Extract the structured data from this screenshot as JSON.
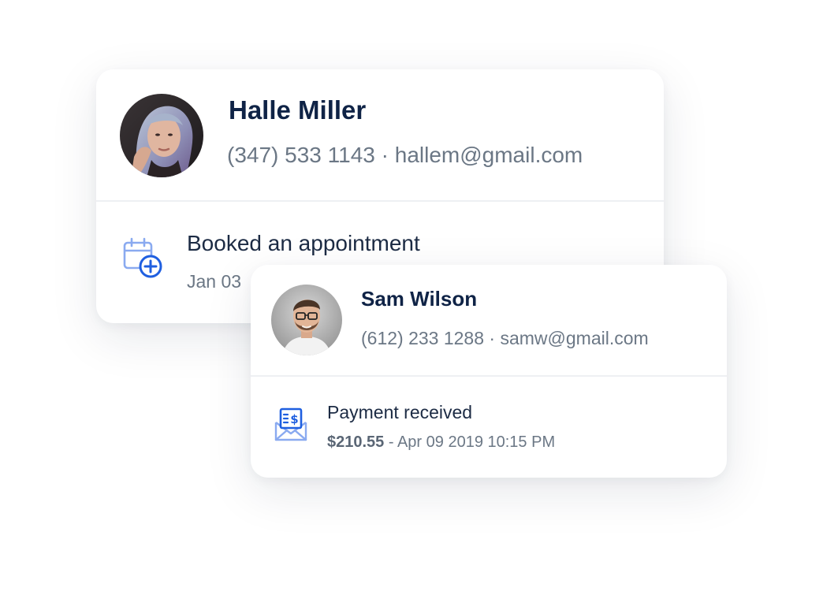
{
  "contacts": [
    {
      "name": "Halle Miller",
      "phone": "(347) 533 1143",
      "separator": " · ",
      "email": "hallem@gmail.com",
      "activity": {
        "icon": "calendar-add-icon",
        "title": "Booked an appointment",
        "date": "Jan 03"
      }
    },
    {
      "name": "Sam Wilson",
      "phone": "(612) 233 1288",
      "separator": " · ",
      "email": "samw@gmail.com",
      "activity": {
        "icon": "payment-envelope-icon",
        "title": "Payment received",
        "amount": "$210.55",
        "separator": " - ",
        "datetime": "Apr 09 2019 10:15 PM"
      }
    }
  ],
  "colors": {
    "name_text": "#0f2346",
    "secondary_text": "#6b7785",
    "icon_light_blue": "#8aaaf0",
    "icon_blue": "#1f5fe0"
  }
}
